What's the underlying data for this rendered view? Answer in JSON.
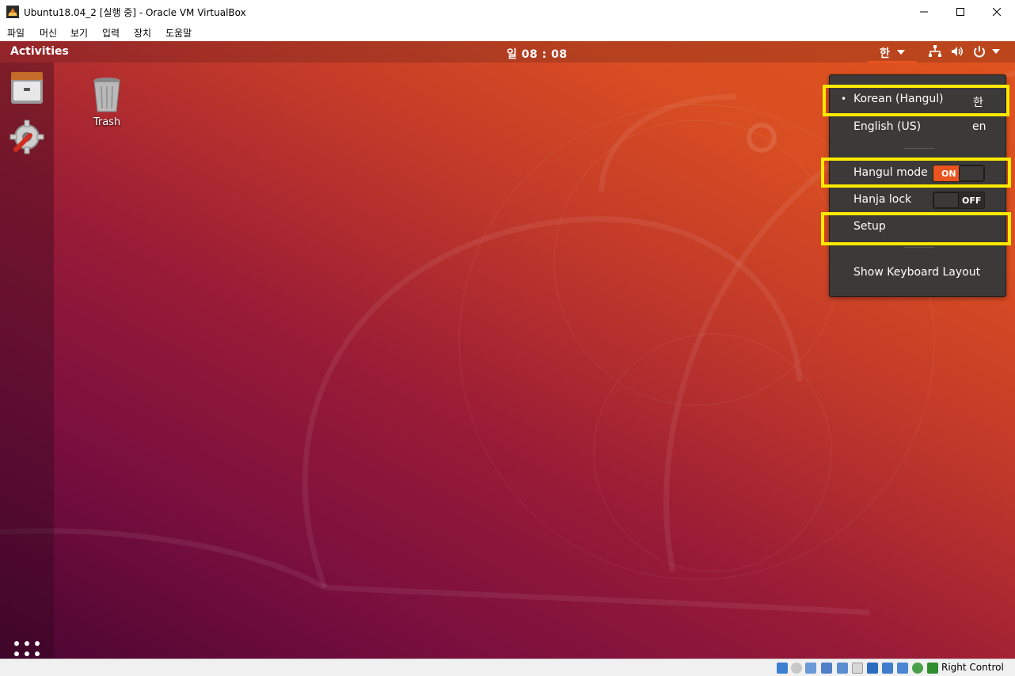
{
  "window": {
    "title": "Ubuntu18.04_2 [실행 중] - Oracle VM VirtualBox",
    "menu": [
      "파일",
      "머신",
      "보기",
      "입력",
      "장치",
      "도움말"
    ]
  },
  "gnome": {
    "activities": "Activities",
    "clock": "일 08 : 08",
    "ime_indicator": "한",
    "tray_icons": [
      "network-icon",
      "volume-icon",
      "power-icon"
    ]
  },
  "desktop": {
    "trash_label": "Trash"
  },
  "dropdown": {
    "korean_label": "Korean (Hangul)",
    "korean_short": "한",
    "english_label": "English (US)",
    "english_short": "en",
    "hangul_mode_label": "Hangul mode",
    "hangul_mode_state": "ON",
    "hanja_lock_label": "Hanja lock",
    "hanja_lock_state": "OFF",
    "setup_label": "Setup",
    "keyboard_layout_label": "Show Keyboard Layout"
  },
  "statusbar": {
    "host_key": "Right Control"
  },
  "colors": {
    "ubuntu_orange": "#e95420",
    "menu_bg": "#3b3a38",
    "highlight": "#ffea00"
  }
}
